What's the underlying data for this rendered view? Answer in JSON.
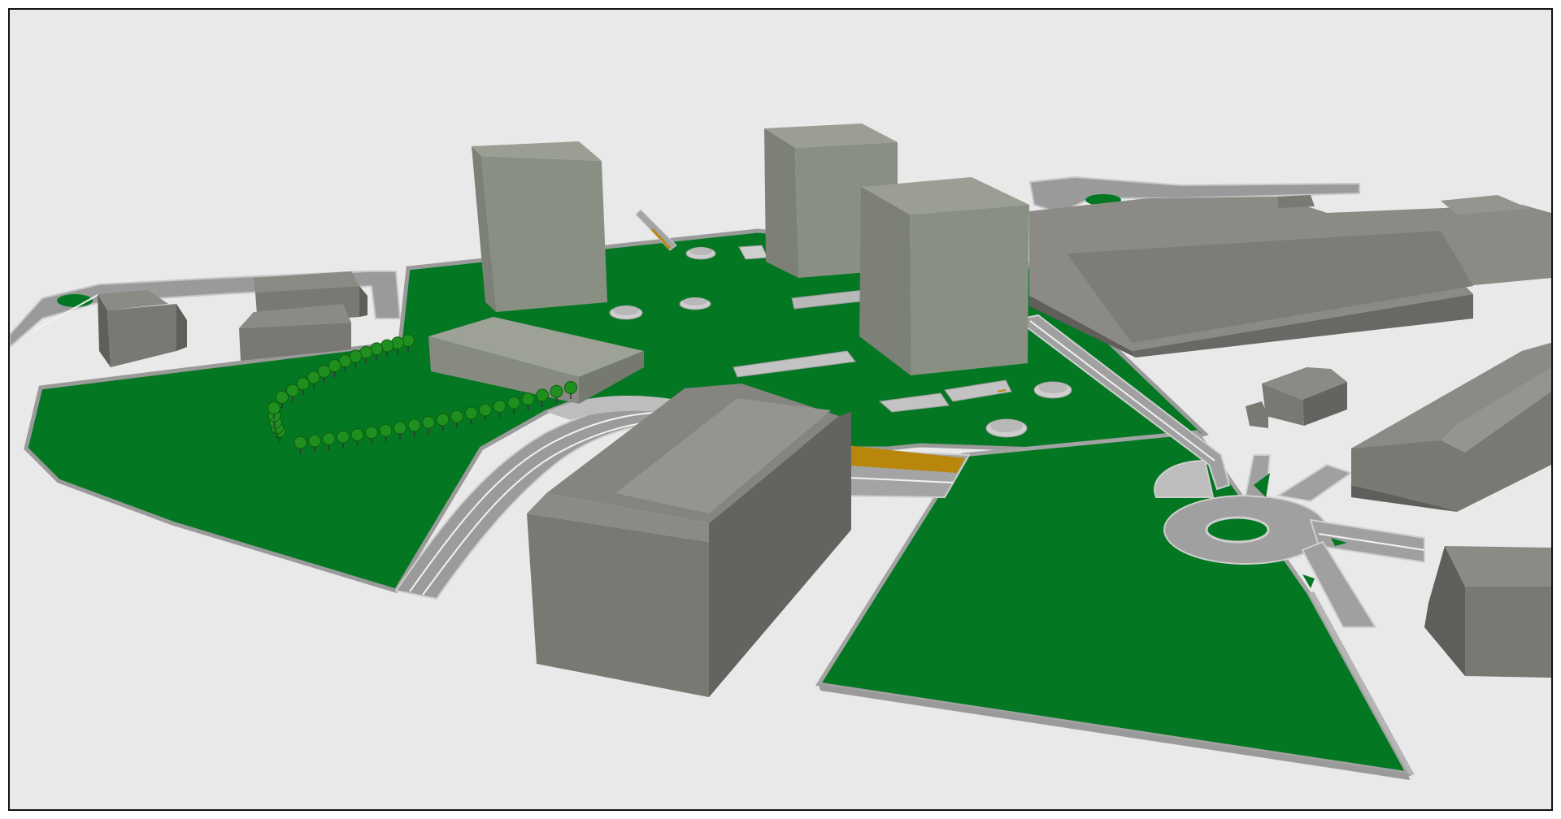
{
  "scene": {
    "kind": "3d-site-model-render",
    "background_color": "#e9e9e9",
    "frame_color": "#111111",
    "colors": {
      "grass": "#047722",
      "grass_edge": "#9a9a9a",
      "road": "#8f8f8f",
      "road_edge": "#c4c4c4",
      "road_marking": "#f2f2f2",
      "tower_front": "#8a8f84",
      "tower_side": "#7c8077",
      "tower_top": "#9a9e93",
      "building_front": "#7a7872",
      "building_side": "#646360",
      "building_top": "#8c8a85",
      "amber_strip": "#b8860b",
      "tree_canopy": "#1f8f1f",
      "tree_trunk": "#333333"
    }
  }
}
